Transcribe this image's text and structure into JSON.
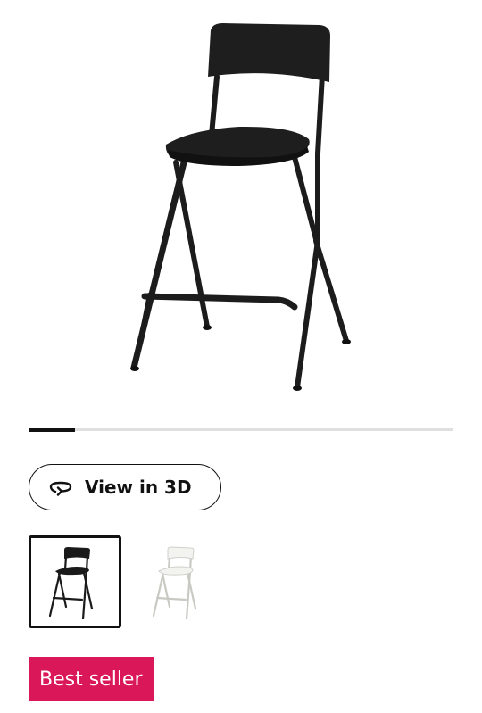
{
  "product": {
    "main_image_icon": "black-bar-stool-image"
  },
  "carousel": {
    "progress": 0.11
  },
  "actions": {
    "view_3d_label": "View in 3D",
    "view_3d_icon": "rotate-3d-icon"
  },
  "variants": [
    {
      "icon": "black-bar-stool-thumbnail",
      "selected": true,
      "color": "#1a1a1a"
    },
    {
      "icon": "white-bar-stool-thumbnail",
      "selected": false,
      "color": "#f3f3f0"
    }
  ],
  "badge": {
    "label": "Best seller",
    "color": "#da1859"
  }
}
